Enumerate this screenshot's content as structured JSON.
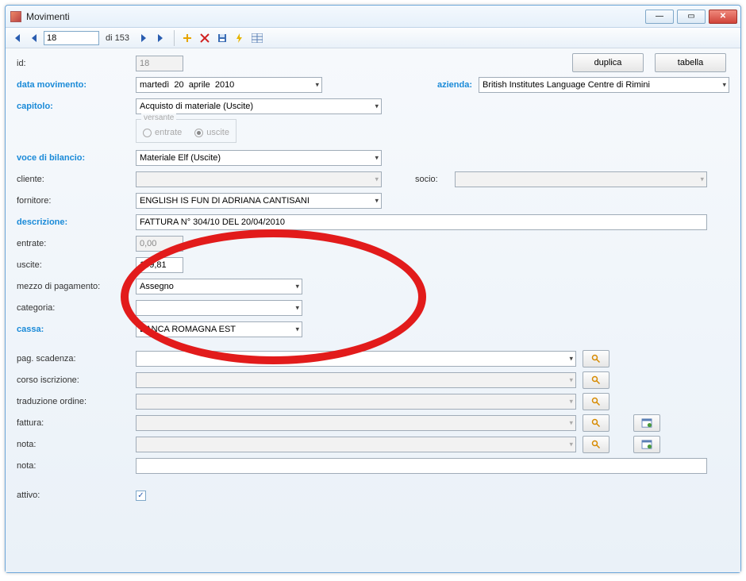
{
  "window": {
    "title": "Movimenti"
  },
  "toolbar": {
    "record_index": "18",
    "record_total_prefix": "di ",
    "record_total": "153"
  },
  "buttons": {
    "duplica": "duplica",
    "tabella": "tabella"
  },
  "labels": {
    "id": "id:",
    "data_movimento": "data movimento:",
    "azienda": "azienda:",
    "capitolo": "capitolo:",
    "versante": "versante",
    "entrate_radio": "entrate",
    "uscite_radio": "uscite",
    "voce_bilancio": "voce di bilancio:",
    "cliente": "cliente:",
    "socio": "socio:",
    "fornitore": "fornitore:",
    "descrizione": "descrizione:",
    "entrate": "entrate:",
    "uscite": "uscite:",
    "mezzo_pagamento": "mezzo di pagamento:",
    "categoria": "categoria:",
    "cassa": "cassa:",
    "pag_scadenza": "pag. scadenza:",
    "corso_iscrizione": "corso iscrizione:",
    "traduzione_ordine": "traduzione ordine:",
    "fattura": "fattura:",
    "nota": "nota:",
    "nota2": "nota:",
    "attivo": "attivo:"
  },
  "values": {
    "id": "18",
    "date_weekday": "martedì",
    "date_day": "20",
    "date_month": "aprile",
    "date_year": "2010",
    "azienda": "British Institutes Language Centre di Rimini",
    "capitolo": "Acquisto di materiale (Uscite)",
    "voce_bilancio": "Materiale Elf (Uscite)",
    "cliente": "",
    "socio": "",
    "fornitore": "ENGLISH IS FUN DI ADRIANA CANTISANI",
    "descrizione": "FATTURA N° 304/10 DEL 20/04/2010",
    "entrate": "0,00",
    "uscite": "109,81",
    "mezzo_pagamento": "Assegno",
    "categoria": "",
    "cassa": "BANCA ROMAGNA EST",
    "pag_scadenza": "",
    "corso_iscrizione": "",
    "traduzione_ordine": "",
    "fattura": "",
    "nota": "",
    "nota2": "",
    "attivo": true
  }
}
